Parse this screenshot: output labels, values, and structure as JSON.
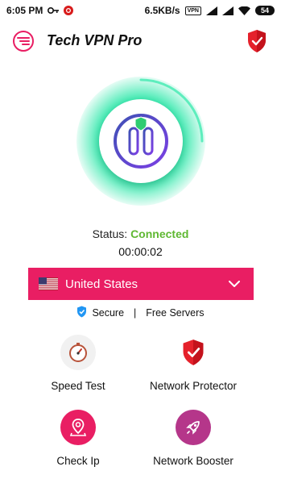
{
  "status_bar": {
    "time": "6:05 PM",
    "speed": "6.5KB/s",
    "vpn_badge": "VPN",
    "battery": "54"
  },
  "header": {
    "title": "Tech VPN Pro"
  },
  "connection": {
    "status_label": "Status: ",
    "status_value": "Connected",
    "timer": "00:00:02"
  },
  "server": {
    "country": "United States"
  },
  "info": {
    "secure": "Secure",
    "separator": "|",
    "free": "Free Servers"
  },
  "features": [
    {
      "label": "Speed Test",
      "icon": "stopwatch-icon"
    },
    {
      "label": "Network Protector",
      "icon": "shield-check-icon"
    },
    {
      "label": "Check Ip",
      "icon": "location-pin-icon"
    },
    {
      "label": "Network Booster",
      "icon": "rocket-icon"
    }
  ],
  "colors": {
    "accent": "#e91e63",
    "connected": "#5fb832",
    "glow": "#2ee8aa",
    "power_ring": "#3f51b5"
  }
}
